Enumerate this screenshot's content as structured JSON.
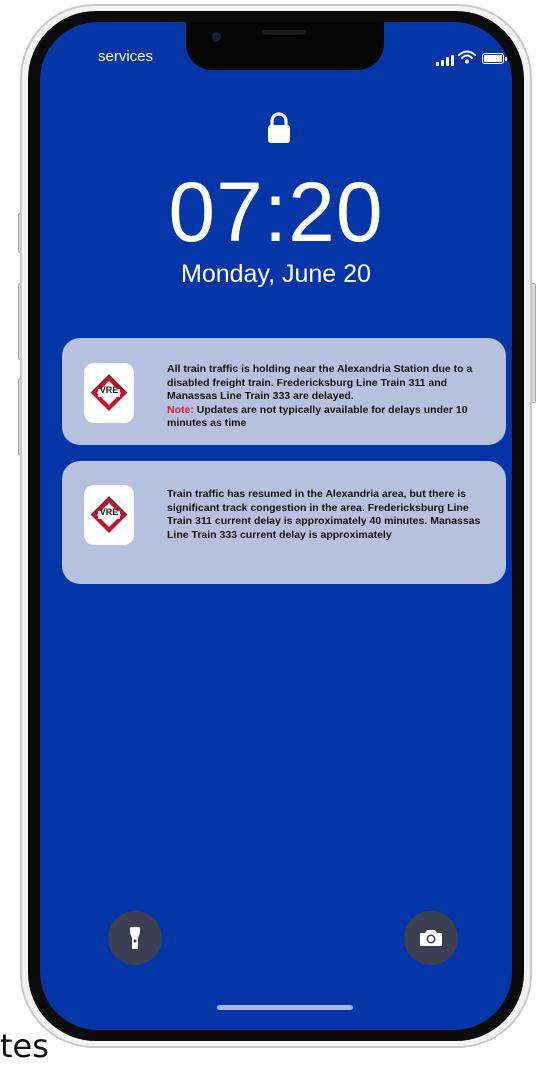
{
  "status_bar": {
    "carrier": "services"
  },
  "lock_screen": {
    "time": "07:20",
    "date": "Monday, June 20"
  },
  "notifications": [
    {
      "app": "VRE",
      "message": "All train traffic is holding near the Alexandria Station due to a disabled freight train. Fredericksburg Line Train 311 and Manassas Line Train 333 are delayed.",
      "note_label": "Note:",
      "note_text": " Updates are not typically available for delays under 10 minutes as time"
    },
    {
      "app": "VRE",
      "message": "Train traffic has resumed in the Alexandria area, but there is significant track congestion in the area. Fredericksburg Line Train 311 current delay is approximately 40 minutes. Manassas Line Train 333 current delay is approximately"
    }
  ],
  "quick_actions": {
    "left": "flashlight-icon",
    "right": "camera-icon"
  },
  "caption": "tes",
  "colors": {
    "screen": "#0435a6",
    "notification_bg": "#b6c0df",
    "note_red": "#d0213b",
    "logo_red": "#c8102e"
  }
}
